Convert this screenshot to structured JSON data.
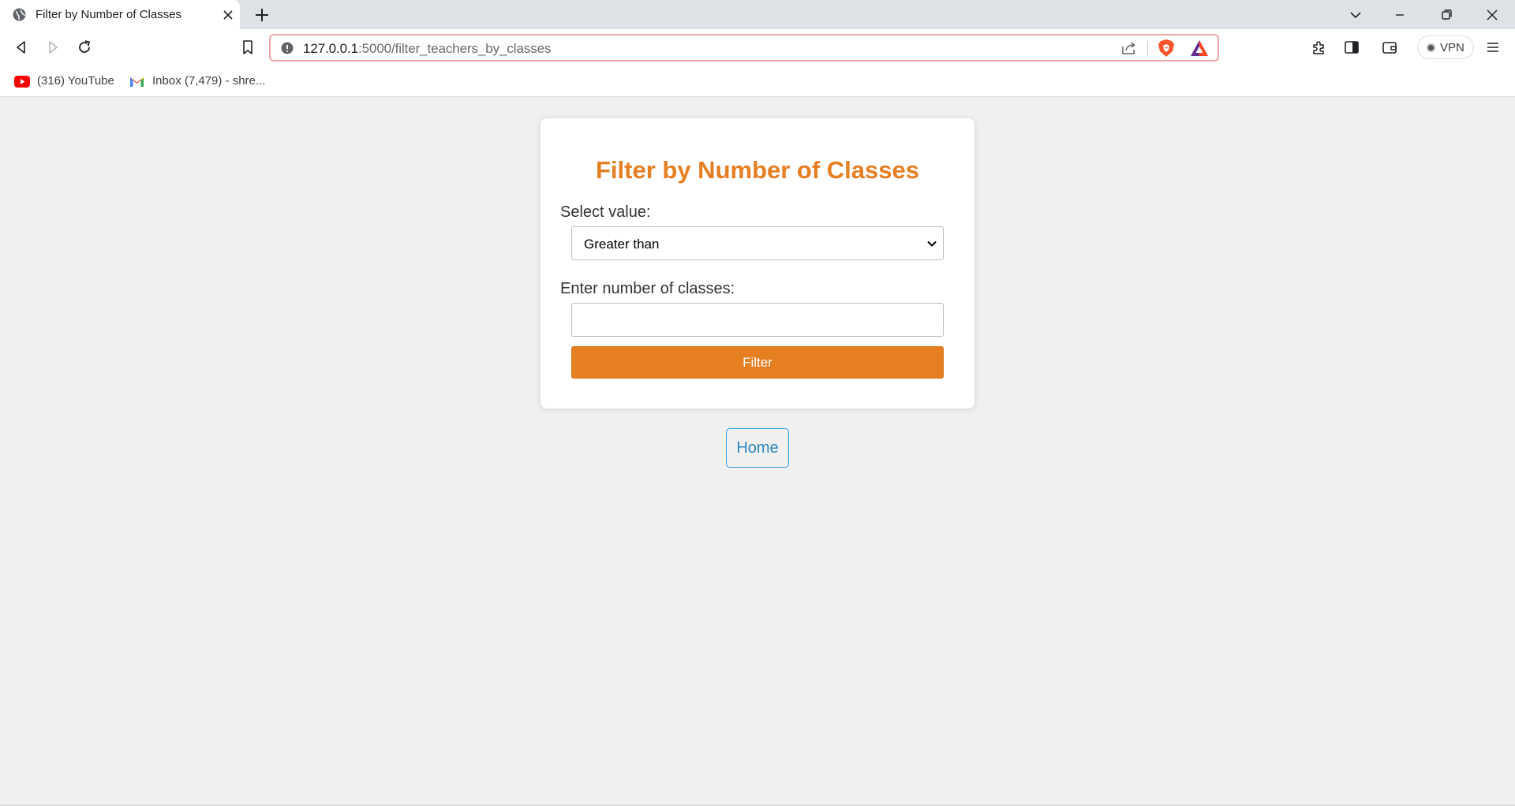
{
  "browser": {
    "tab": {
      "title": "Filter by Number of Classes",
      "favicon": "globe-icon"
    },
    "address_bar": {
      "url_host": "127.0.0.1",
      "url_rest": ":5000/filter_teachers_by_classes"
    },
    "vpn_label": "VPN",
    "bookmarks": [
      {
        "label": "(316) YouTube",
        "icon": "youtube-icon"
      },
      {
        "label": "Inbox (7,479) - shre...",
        "icon": "gmail-icon"
      }
    ]
  },
  "page": {
    "heading": "Filter by Number of Classes",
    "select_label": "Select value:",
    "select_value": "Greater than",
    "number_label": "Enter number of classes:",
    "number_value": "",
    "filter_button": "Filter",
    "home_button": "Home"
  },
  "colors": {
    "accent": "#e67e22",
    "link": "#3498db",
    "page_background": "#f0f0f0"
  }
}
